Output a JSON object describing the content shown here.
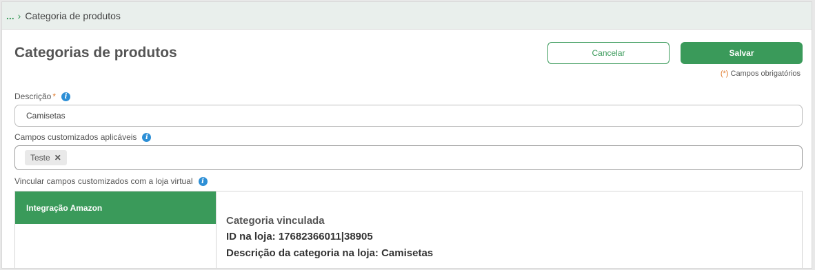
{
  "breadcrumb": {
    "ellipsis": "...",
    "separator": "›",
    "current": "Categoria de produtos"
  },
  "page": {
    "title": "Categorias de produtos"
  },
  "actions": {
    "cancel_label": "Cancelar",
    "save_label": "Salvar",
    "required_mark": "(*)",
    "required_text": "Campos obrigatórios"
  },
  "fields": {
    "description": {
      "label": "Descrição",
      "required_mark": "*",
      "value": "Camisetas"
    },
    "custom_fields": {
      "label": "Campos customizados aplicáveis",
      "tags": [
        "Teste"
      ],
      "remove_glyph": "✕"
    },
    "link_custom_fields": {
      "label": "Vincular campos customizados com a loja virtual"
    }
  },
  "integration_panel": {
    "tab_label": "Integração Amazon",
    "heading": "Categoria vinculada",
    "store_id_line": "ID na loja: 17682366011|38905",
    "store_desc_line": "Descrição da categoria na loja: Camisetas"
  },
  "icons": {
    "info_glyph": "i"
  },
  "colors": {
    "brand_green": "#3a9a5a",
    "info_blue": "#2d8fd6",
    "required_orange": "#e07a2c"
  }
}
